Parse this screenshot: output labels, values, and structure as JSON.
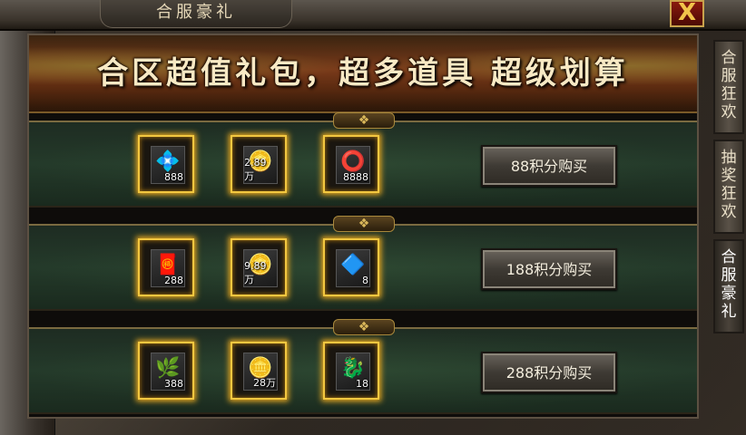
{
  "window": {
    "title": "合服豪礼",
    "close_label": "X"
  },
  "banner": {
    "text": "合区超值礼包，超多道具 超级划算"
  },
  "side_tabs": [
    {
      "line1": "合服",
      "line2": "狂欢"
    },
    {
      "line1": "抽奖",
      "line2": "狂欢"
    },
    {
      "line1": "合服",
      "line2": "豪礼"
    }
  ],
  "packages": [
    {
      "items": [
        {
          "icon": "green-gem-icon",
          "glyph": "💠",
          "count": "888"
        },
        {
          "icon": "gold-coins-icon",
          "glyph": "🪙",
          "count": "2.89万"
        },
        {
          "icon": "ring-icon",
          "glyph": "⭕",
          "count": "8888"
        }
      ],
      "buy_label": "88积分购买"
    },
    {
      "items": [
        {
          "icon": "red-scroll-icon",
          "glyph": "🧧",
          "count": "288"
        },
        {
          "icon": "gold-coins-icon",
          "glyph": "🪙",
          "count": "9.89万"
        },
        {
          "icon": "blue-orb-icon",
          "glyph": "🔷",
          "count": "8"
        }
      ],
      "buy_label": "188积分购买"
    },
    {
      "items": [
        {
          "icon": "potion-icon",
          "glyph": "🌿",
          "count": "388"
        },
        {
          "icon": "gold-coins-icon",
          "glyph": "🪙",
          "count": "28万"
        },
        {
          "icon": "golden-dragon-icon",
          "glyph": "🐉",
          "count": "18"
        }
      ],
      "buy_label": "288积分购买"
    }
  ],
  "colors": {
    "slot_border": "#f2c740",
    "banner_text": "#f8e9c4"
  }
}
